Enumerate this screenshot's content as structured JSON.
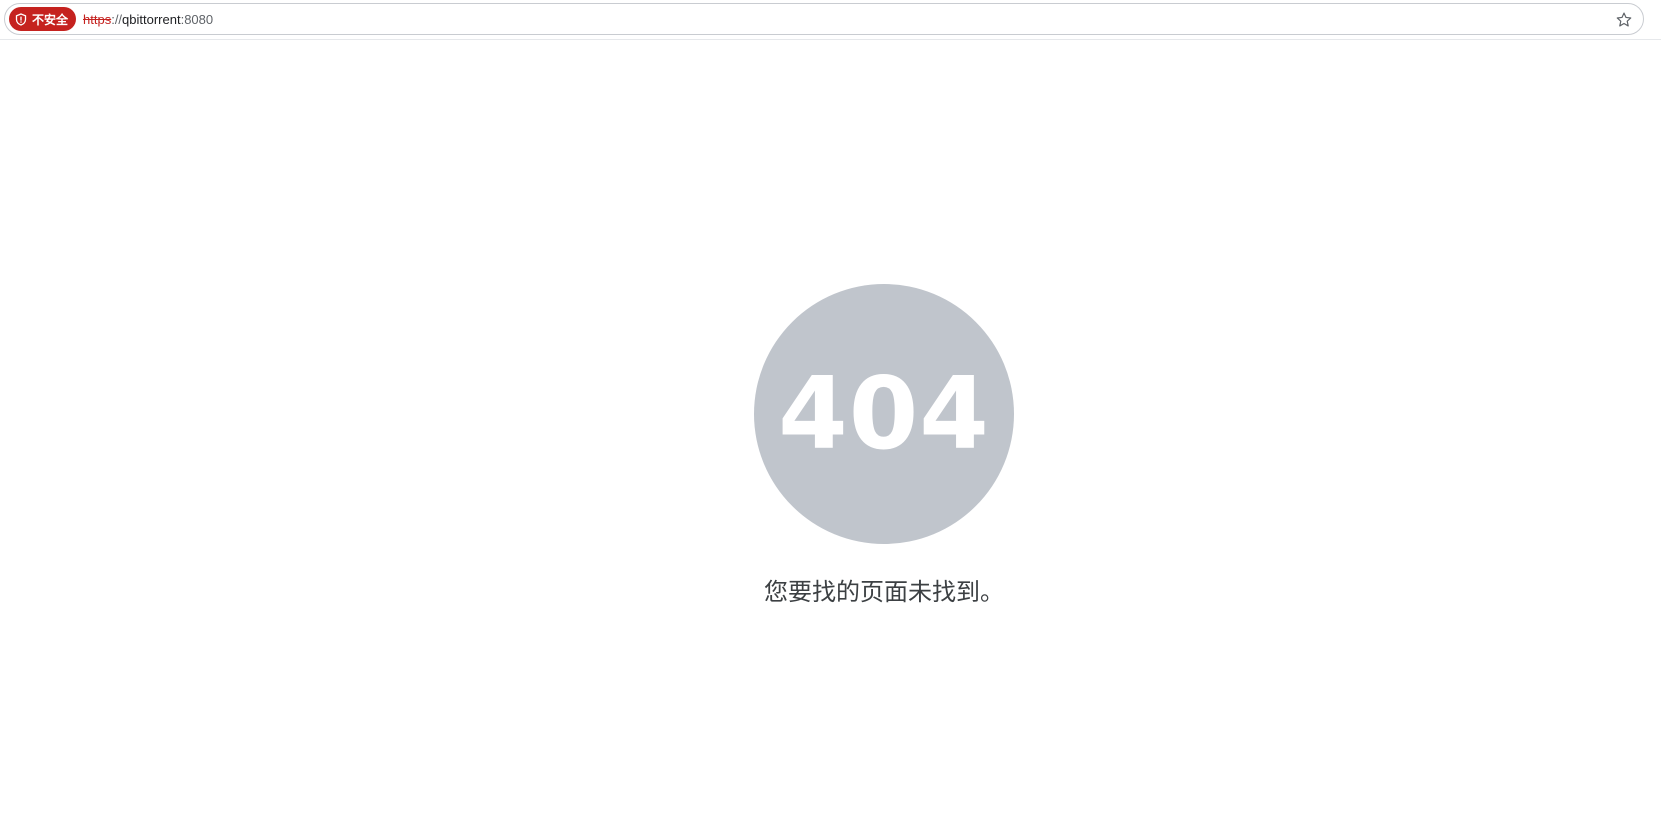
{
  "address_bar": {
    "security_label": "不安全",
    "url_scheme": "https",
    "url_separator": "://",
    "url_host": "qbittorrent",
    "url_port": ":8080"
  },
  "icons": {
    "security": "shield-warning-icon",
    "bookmark": "star-icon"
  },
  "error_page": {
    "code": "404",
    "message": "您要找的页面未找到。"
  },
  "colors": {
    "warning": "#c5221f",
    "circle": "#c0c5cc",
    "message_text": "#3c4043"
  }
}
